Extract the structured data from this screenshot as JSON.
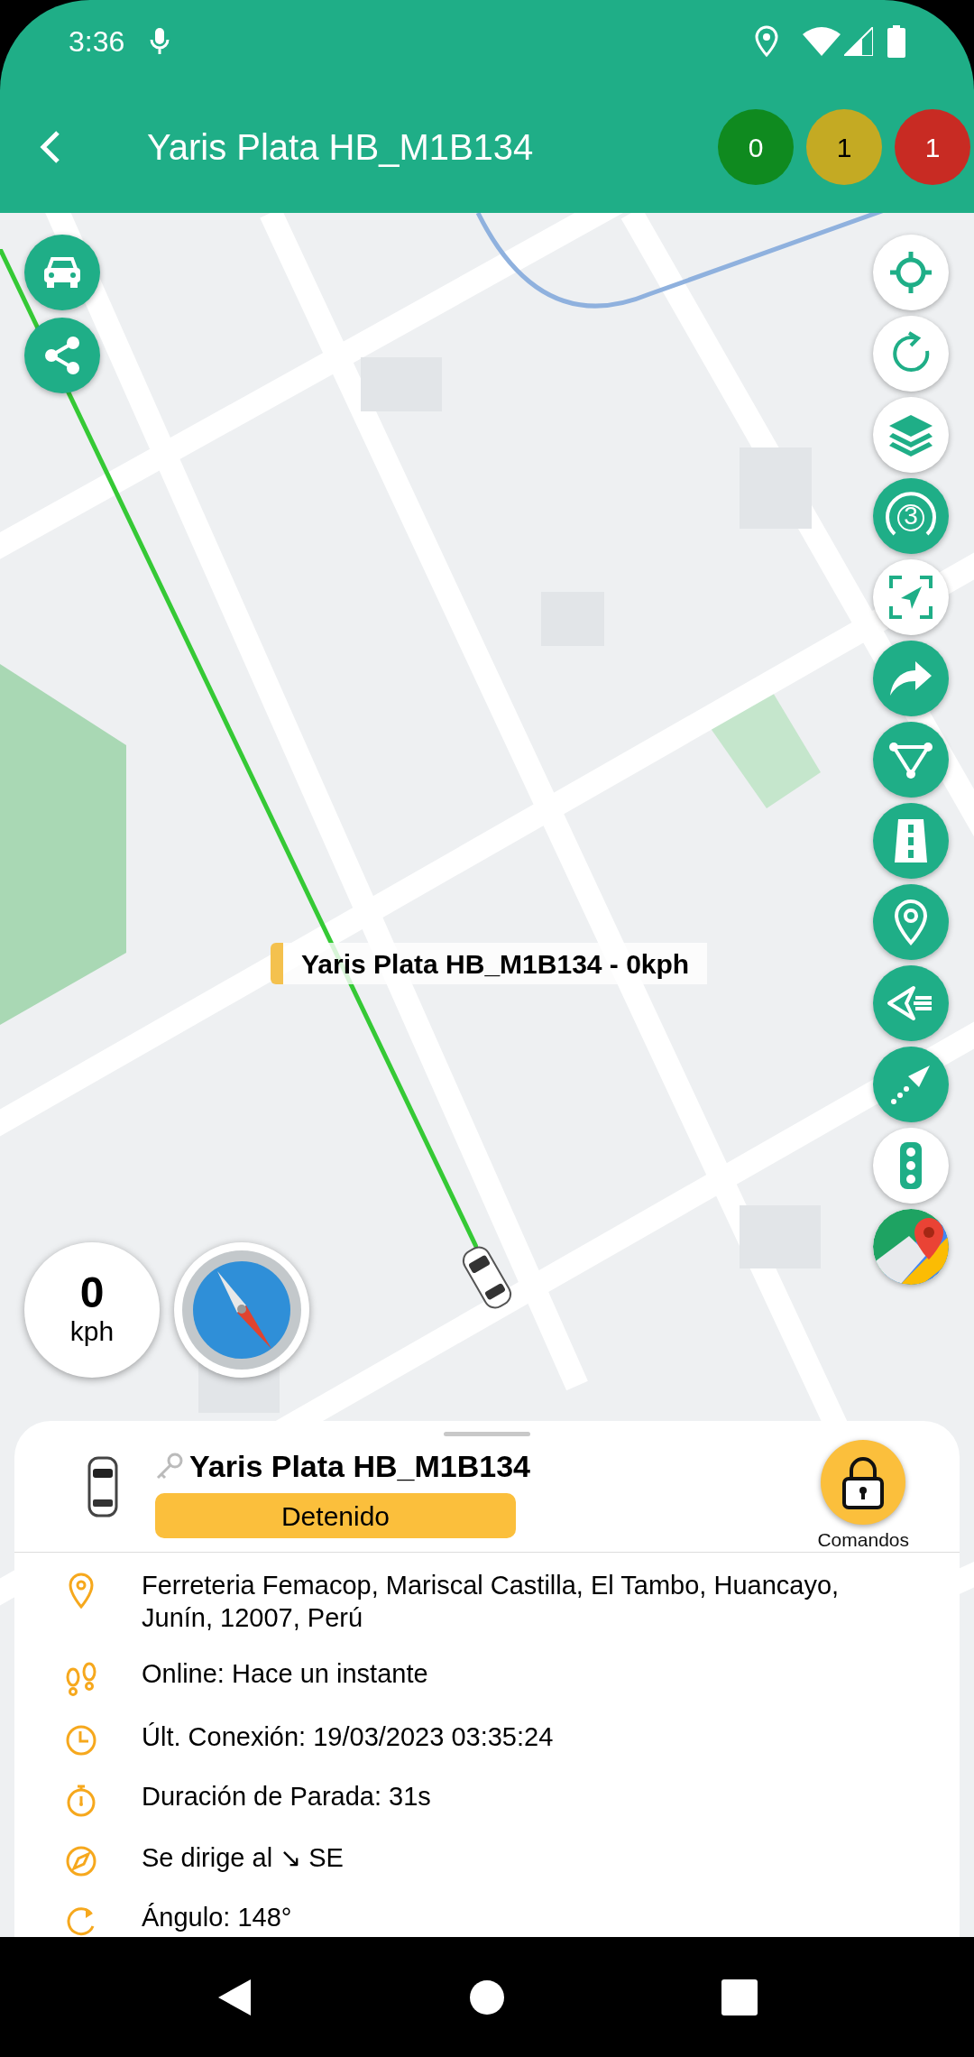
{
  "status_bar": {
    "time": "3:36"
  },
  "header": {
    "title": "Yaris Plata HB_M1B134",
    "counters": [
      {
        "count": "0",
        "color": "#0f8a1f"
      },
      {
        "count": "1",
        "color": "#c4aa23"
      },
      {
        "count": "1",
        "color": "#c82b23"
      }
    ]
  },
  "map": {
    "side_tools": [
      {
        "kind": "vehicle"
      },
      {
        "kind": "share"
      }
    ],
    "tools": [
      {
        "kind": "locate"
      },
      {
        "kind": "refresh"
      },
      {
        "kind": "layers"
      },
      {
        "kind": "zoom-level",
        "label": "3"
      },
      {
        "kind": "fit"
      },
      {
        "kind": "forward"
      },
      {
        "kind": "route"
      },
      {
        "kind": "road"
      },
      {
        "kind": "pin"
      },
      {
        "kind": "send-list"
      },
      {
        "kind": "navigate"
      },
      {
        "kind": "traffic"
      },
      {
        "kind": "maps"
      }
    ],
    "vehicle_label": "Yaris Plata HB_M1B134 - 0kph",
    "speed": {
      "value": "0",
      "unit": "kph"
    }
  },
  "sheet": {
    "title": "Yaris Plata HB_M1B134",
    "status": "Detenido",
    "commands_label": "Comandos",
    "details": [
      {
        "kind": "address",
        "text": "Ferreteria Femacop, Mariscal Castilla, El Tambo, Huancayo, Junín, 12007, Perú"
      },
      {
        "kind": "online",
        "text": "Online: Hace un instante"
      },
      {
        "kind": "last-connection",
        "text": "Últ. Conexión: 19/03/2023 03:35:24"
      },
      {
        "kind": "stop-duration",
        "text": "Duración de Parada: 31s"
      },
      {
        "kind": "heading",
        "text": "Se dirige al ↘ SE"
      },
      {
        "kind": "angle",
        "text": "Ángulo: 148°"
      }
    ]
  }
}
